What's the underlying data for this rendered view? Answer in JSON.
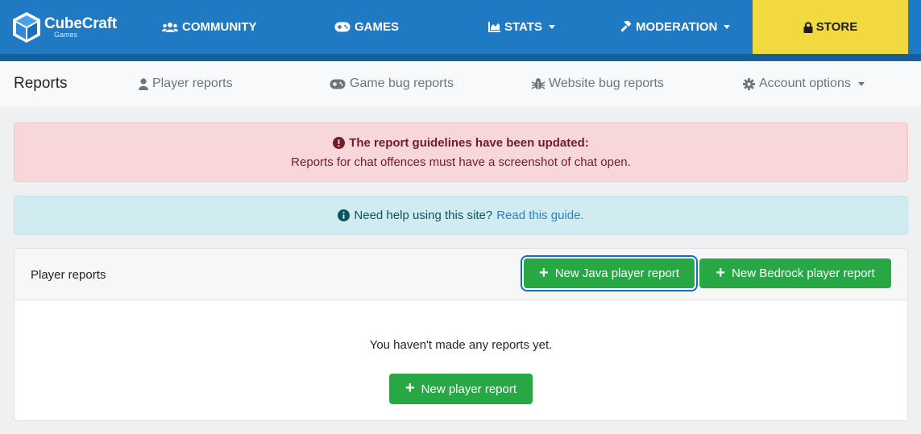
{
  "brand": {
    "name": "CubeCraft",
    "sub": "Games",
    "accent": "#2079c3",
    "store_color": "#f1d93f"
  },
  "nav": {
    "community": "COMMUNITY",
    "games": "GAMES",
    "stats": "STATS",
    "moderation": "MODERATION",
    "store": "STORE"
  },
  "subnav": {
    "title": "Reports",
    "player_reports": "Player reports",
    "game_bug_reports": "Game bug reports",
    "website_bug_reports": "Website bug reports",
    "account_options": "Account options"
  },
  "alert_danger": {
    "heading": "The report guidelines have been updated:",
    "body": "Reports for chat offences must have a screenshot of chat open."
  },
  "alert_info": {
    "text": "Need help using this site?",
    "link": "Read this guide."
  },
  "card": {
    "title": "Player reports",
    "java_button": "New Java player report",
    "bedrock_button": "New Bedrock player report",
    "empty_text": "You haven't made any reports yet.",
    "new_button": "New player report"
  },
  "icons": [
    "users-icon",
    "gamepad-icon",
    "chart-area-icon",
    "gavel-icon",
    "lock-icon",
    "user-icon",
    "bug-icon",
    "gear-icon",
    "exclamation-circle-icon",
    "info-circle-icon",
    "plus-icon"
  ]
}
